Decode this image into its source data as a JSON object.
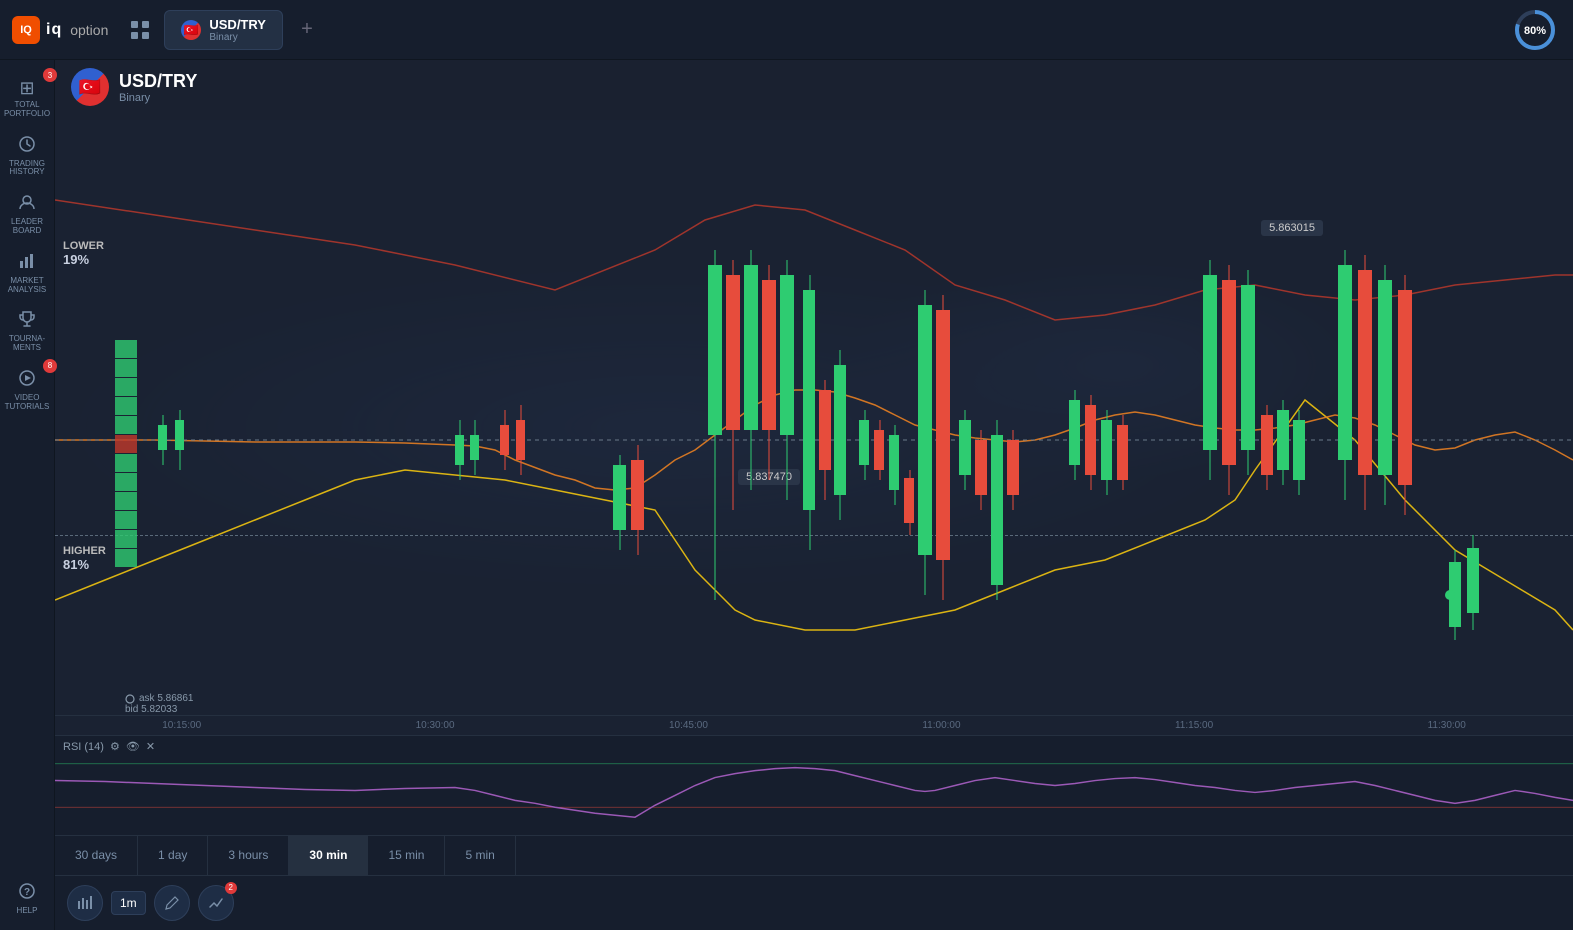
{
  "app": {
    "logo_icon": "IQ",
    "logo_text": "iq",
    "logo_option": "option",
    "grid_icon": "⊞"
  },
  "active_tab": {
    "currency_pair": "USD/TRY",
    "type": "Binary"
  },
  "progress": {
    "value": 80,
    "label": "80%"
  },
  "sidebar": {
    "items": [
      {
        "icon": "⊞",
        "label": "TOTAL\nPORTFOLIO",
        "badge": "3"
      },
      {
        "icon": "🕐",
        "label": "TRADING\nHISTORY",
        "badge": null
      },
      {
        "icon": "🏆",
        "label": "LEADER\nBOARD",
        "badge": null
      },
      {
        "icon": "📊",
        "label": "MARKET\nANALYSIS",
        "badge": null
      },
      {
        "icon": "🏅",
        "label": "TOURNA-\nMENTS",
        "badge": null
      },
      {
        "icon": "▶",
        "label": "VIDEO\nTUTORIALS",
        "badge": "8"
      },
      {
        "icon": "?",
        "label": "HELP",
        "badge": null
      }
    ]
  },
  "pair": {
    "name": "USD/TRY",
    "type": "Binary",
    "flag_emoji": "🇹🇷"
  },
  "direction": {
    "lower": {
      "label": "LOWER",
      "percent": "19%"
    },
    "higher": {
      "label": "HIGHER",
      "percent": "81%"
    }
  },
  "prices": {
    "label_top": "5.863015",
    "label_mid": "5.837470",
    "ask": "ask 5.86861",
    "bid": "bid 5.82033"
  },
  "rsi": {
    "label": "RSI (14)",
    "settings_icon": "⚙",
    "eye_icon": "👁",
    "close_icon": "✕"
  },
  "timeframes": [
    {
      "label": "30 days",
      "active": false
    },
    {
      "label": "1 day",
      "active": false
    },
    {
      "label": "3 hours",
      "active": false
    },
    {
      "label": "30 min",
      "active": true
    },
    {
      "label": "15 min",
      "active": false
    },
    {
      "label": "5 min",
      "active": false
    }
  ],
  "chart_tools": [
    {
      "icon": "📊",
      "label": "1m"
    },
    {
      "icon": "✎",
      "label": ""
    },
    {
      "icon": "2",
      "label": ""
    }
  ],
  "xtimes": [
    "10:15:00",
    "10:30:00",
    "10:45:00",
    "11:00:00",
    "11:15:00",
    "11:30:00"
  ]
}
